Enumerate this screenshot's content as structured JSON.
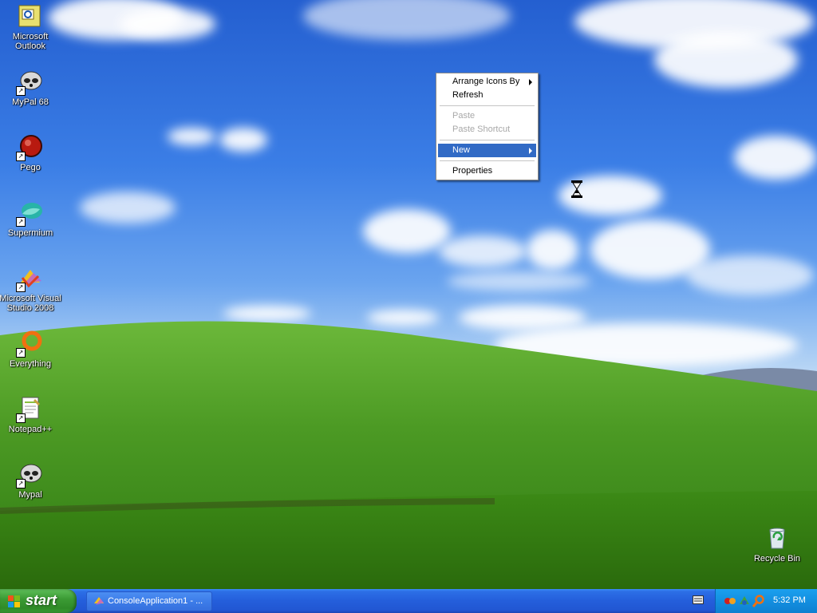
{
  "desktop": {
    "icons": [
      {
        "label": "Microsoft Outlook",
        "icon": "outlook-icon"
      },
      {
        "label": "MyPal 68",
        "icon": "mypal-icon"
      },
      {
        "label": "Pego",
        "icon": "pego-icon"
      },
      {
        "label": "Supermium",
        "icon": "supermium-icon"
      },
      {
        "label": "Microsoft Visual Studio 2008",
        "icon": "visual-studio-icon"
      },
      {
        "label": "Everything",
        "icon": "everything-icon"
      },
      {
        "label": "Notepad++",
        "icon": "notepadpp-icon"
      },
      {
        "label": "Mypal",
        "icon": "mypal-icon"
      },
      {
        "label": "Recycle Bin",
        "icon": "recycle-bin-icon"
      }
    ]
  },
  "context_menu": {
    "items": [
      {
        "label": "Arrange Icons By",
        "enabled": true,
        "submenu": true
      },
      {
        "label": "Refresh",
        "enabled": true
      },
      {
        "label": "Paste",
        "enabled": false
      },
      {
        "label": "Paste Shortcut",
        "enabled": false
      },
      {
        "label": "New",
        "enabled": true,
        "submenu": true,
        "selected": true
      },
      {
        "label": "Properties",
        "enabled": true
      }
    ],
    "selection_color": "#316ac5"
  },
  "cursor": {
    "icon": "hourglass-cursor-icon"
  },
  "taskbar": {
    "start_label": "start",
    "buttons": [
      {
        "label": "ConsoleApplication1 - ...",
        "icon": "visual-studio-icon"
      }
    ],
    "tray": {
      "icons": [
        "keyboard-icon",
        "mypal-tray-icon",
        "network-tray-icon",
        "search-tray-icon"
      ],
      "clock": "5:32 PM"
    },
    "colors": {
      "bar": "#245edb",
      "start": "#3c9b35",
      "tray": "#138fe0"
    }
  }
}
